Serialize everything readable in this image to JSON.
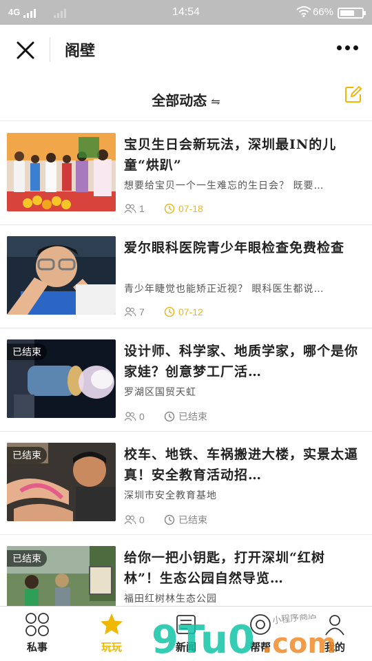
{
  "status": {
    "network": "4G",
    "time": "14:54",
    "battery": "66%",
    "battery_level": 0.66
  },
  "nav": {
    "title": "阁壁"
  },
  "subhead": {
    "title": "全部动态",
    "swap": "⇋"
  },
  "items": [
    {
      "title": "宝贝生日会新玩法，深圳最IN的儿童“烘趴”",
      "desc": "想要给宝贝一个一生难忘的生日会？ 既要…",
      "count": "1",
      "time": "07-18",
      "active": true,
      "tag": ""
    },
    {
      "title": "爱尔眼科医院青少年眼检查免费检查",
      "desc": "青少年睫觉也能矫正近视？ 眼科医生都说…",
      "count": "7",
      "time": "07-12",
      "active": true,
      "tag": ""
    },
    {
      "title": "设计师、科学家、地质学家，哪个是你家娃？创意梦工厂活…",
      "desc": "罗湖区国贸天虹",
      "count": "0",
      "time": "已结束",
      "active": false,
      "tag": "已结束"
    },
    {
      "title": "校车、地铁、车祸搬进大楼，实景太逼真！安全教育活动招…",
      "desc": "深圳市安全教育基地",
      "count": "0",
      "time": "已结束",
      "active": false,
      "tag": "已结束"
    },
    {
      "title": "给你一把小钥匙，打开深圳“红树林”！生态公园自然导览…",
      "desc": "福田红树林生态公园",
      "count": "",
      "time": "",
      "active": false,
      "tag": "已结束"
    }
  ],
  "tabs": [
    {
      "label": "私事",
      "icon": "grid-icon"
    },
    {
      "label": "玩玩",
      "icon": "star-icon"
    },
    {
      "label": "新闻",
      "icon": "news-icon"
    },
    {
      "label": "帮帮",
      "icon": "help-icon"
    },
    {
      "label": "我的",
      "icon": "user-icon"
    }
  ],
  "watermark": {
    "brand": "9Tu0.com",
    "sub": "小程序商店"
  },
  "colors": {
    "accent": "#f0b800",
    "status_bar": "#bdbdbd",
    "watermark": "#12c4a8"
  }
}
